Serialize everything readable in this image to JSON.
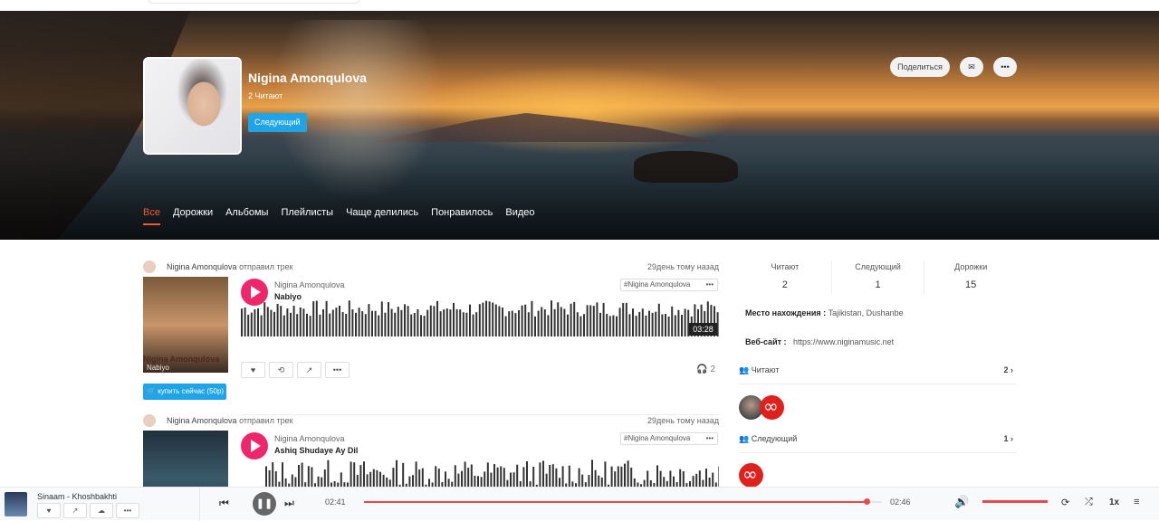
{
  "hero": {
    "artist_name": "Nigina Amonqulova",
    "followers_line": "2 Читают",
    "follow_label": "Следующий",
    "share_label": "Поделиться",
    "message_icon": "envelope-icon",
    "more_icon": "more-dots-icon"
  },
  "tabs": [
    {
      "label": "Все",
      "active": true
    },
    {
      "label": "Дорожки",
      "active": false
    },
    {
      "label": "Альбомы",
      "active": false
    },
    {
      "label": "Плейлисты",
      "active": false
    },
    {
      "label": "Чаще делились",
      "active": false
    },
    {
      "label": "Понравилось",
      "active": false
    },
    {
      "label": "Видео",
      "active": false
    }
  ],
  "posts": [
    {
      "author": "Nigina Amonqulova",
      "action": "отправил трек",
      "time_ago": "29день тому назад",
      "track_artist": "Nigina Amonqulova",
      "track_title": "Nabiyo",
      "tag": "#Nigina Amonqulova",
      "duration": "03:28",
      "plays": "2",
      "buy_label": "купить сейчас (50р)",
      "cover_artist": "Nigina Amonqulova",
      "cover_title": "Nabiyo"
    },
    {
      "author": "Nigina Amonqulova",
      "action": "отправил трек",
      "time_ago": "29день тому назад",
      "track_artist": "Nigina Amonqulova",
      "track_title": "Ashiq Shudaye Ay Dil",
      "tag": "#Nigina Amonqulova"
    }
  ],
  "sidebar": {
    "stats": [
      {
        "label": "Читают",
        "value": "2"
      },
      {
        "label": "Следующий",
        "value": "1"
      },
      {
        "label": "Дорожки",
        "value": "15"
      }
    ],
    "location_label": "Место нахождения :",
    "location_value": "Tajikistan, Dushanbe",
    "website_label": "Веб-сайт :",
    "website_value": "https://www.niginamusic.net",
    "followers_head": "Читают",
    "followers_count": "2",
    "following_head": "Следующий",
    "following_count": "1"
  },
  "player": {
    "now_playing": "Sinaam - Khoshbakhti",
    "elapsed": "02:41",
    "total": "02:46",
    "progress": 0.97,
    "volume": 1.0,
    "speed": "1x"
  }
}
